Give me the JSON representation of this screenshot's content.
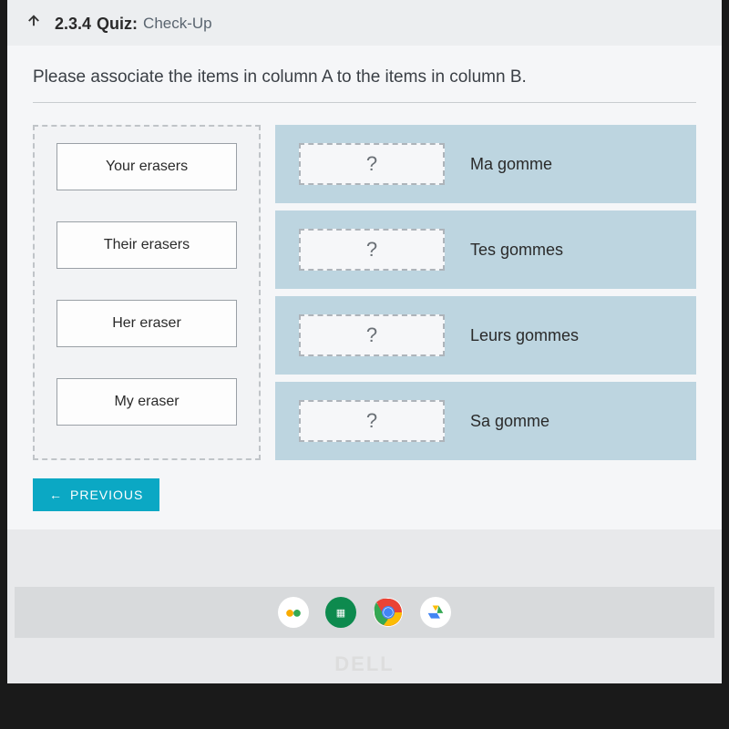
{
  "header": {
    "quiz_number": "2.3.4",
    "quiz_word": "Quiz:",
    "subtitle": "Check-Up"
  },
  "instruction": "Please associate the items in column A to the items in column B.",
  "column_a": {
    "items": [
      {
        "label": "Your erasers"
      },
      {
        "label": "Their erasers"
      },
      {
        "label": "Her eraser"
      },
      {
        "label": "My eraser"
      }
    ]
  },
  "column_b": {
    "placeholder": "?",
    "targets": [
      {
        "label": "Ma gomme"
      },
      {
        "label": "Tes gommes"
      },
      {
        "label": "Leurs gommes"
      },
      {
        "label": "Sa gomme"
      }
    ]
  },
  "nav": {
    "previous": "PREVIOUS"
  },
  "brand": "DELL"
}
